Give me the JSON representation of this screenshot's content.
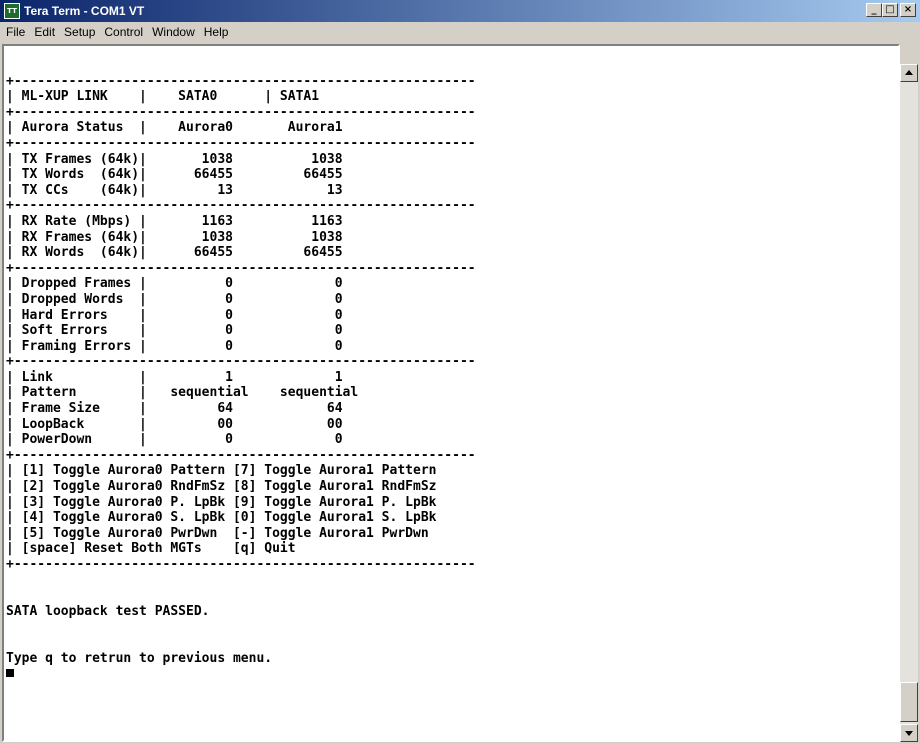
{
  "window": {
    "title": "Tera Term - COM1 VT",
    "icon": "tera-term-app-icon",
    "icon_text": "TT",
    "controls": {
      "minimize": "_",
      "maximize": "□",
      "close": "×"
    }
  },
  "menu": [
    "File",
    "Edit",
    "Setup",
    "Control",
    "Window",
    "Help"
  ],
  "terminal": {
    "lines": [
      "",
      "+-----------------------------------------------------------",
      "| ML-XUP LINK    |    SATA0      | SATA1",
      "+-----------------------------------------------------------",
      "| Aurora Status  |    Aurora0       Aurora1",
      "+-----------------------------------------------------------",
      "| TX Frames (64k)|       1038          1038",
      "| TX Words  (64k)|      66455         66455",
      "| TX CCs    (64k)|         13            13",
      "+-----------------------------------------------------------",
      "| RX Rate (Mbps) |       1163          1163",
      "| RX Frames (64k)|       1038          1038",
      "| RX Words  (64k)|      66455         66455",
      "+-----------------------------------------------------------",
      "| Dropped Frames |          0             0",
      "| Dropped Words  |          0             0",
      "| Hard Errors    |          0             0",
      "| Soft Errors    |          0             0",
      "| Framing Errors |          0             0",
      "+-----------------------------------------------------------",
      "| Link           |          1             1",
      "| Pattern        |   sequential    sequential",
      "| Frame Size     |         64            64",
      "| LoopBack       |         00            00",
      "| PowerDown      |          0             0",
      "+-----------------------------------------------------------",
      "| [1] Toggle Aurora0 Pattern [7] Toggle Aurora1 Pattern",
      "| [2] Toggle Aurora0 RndFmSz [8] Toggle Aurora1 RndFmSz",
      "| [3] Toggle Aurora0 P. LpBk [9] Toggle Aurora1 P. LpBk",
      "| [4] Toggle Aurora0 S. LpBk [0] Toggle Aurora1 S. LpBk",
      "| [5] Toggle Aurora0 PwrDwn  [-] Toggle Aurora1 PwrDwn",
      "| [space] Reset Both MGTs    [q] Quit",
      "+-----------------------------------------------------------",
      "",
      "",
      "SATA loopback test PASSED.",
      "",
      "",
      "Type q to retrun to previous menu."
    ]
  },
  "scrollbar": {
    "up_icon": "scroll-up-arrow-icon",
    "down_icon": "scroll-down-arrow-icon"
  }
}
